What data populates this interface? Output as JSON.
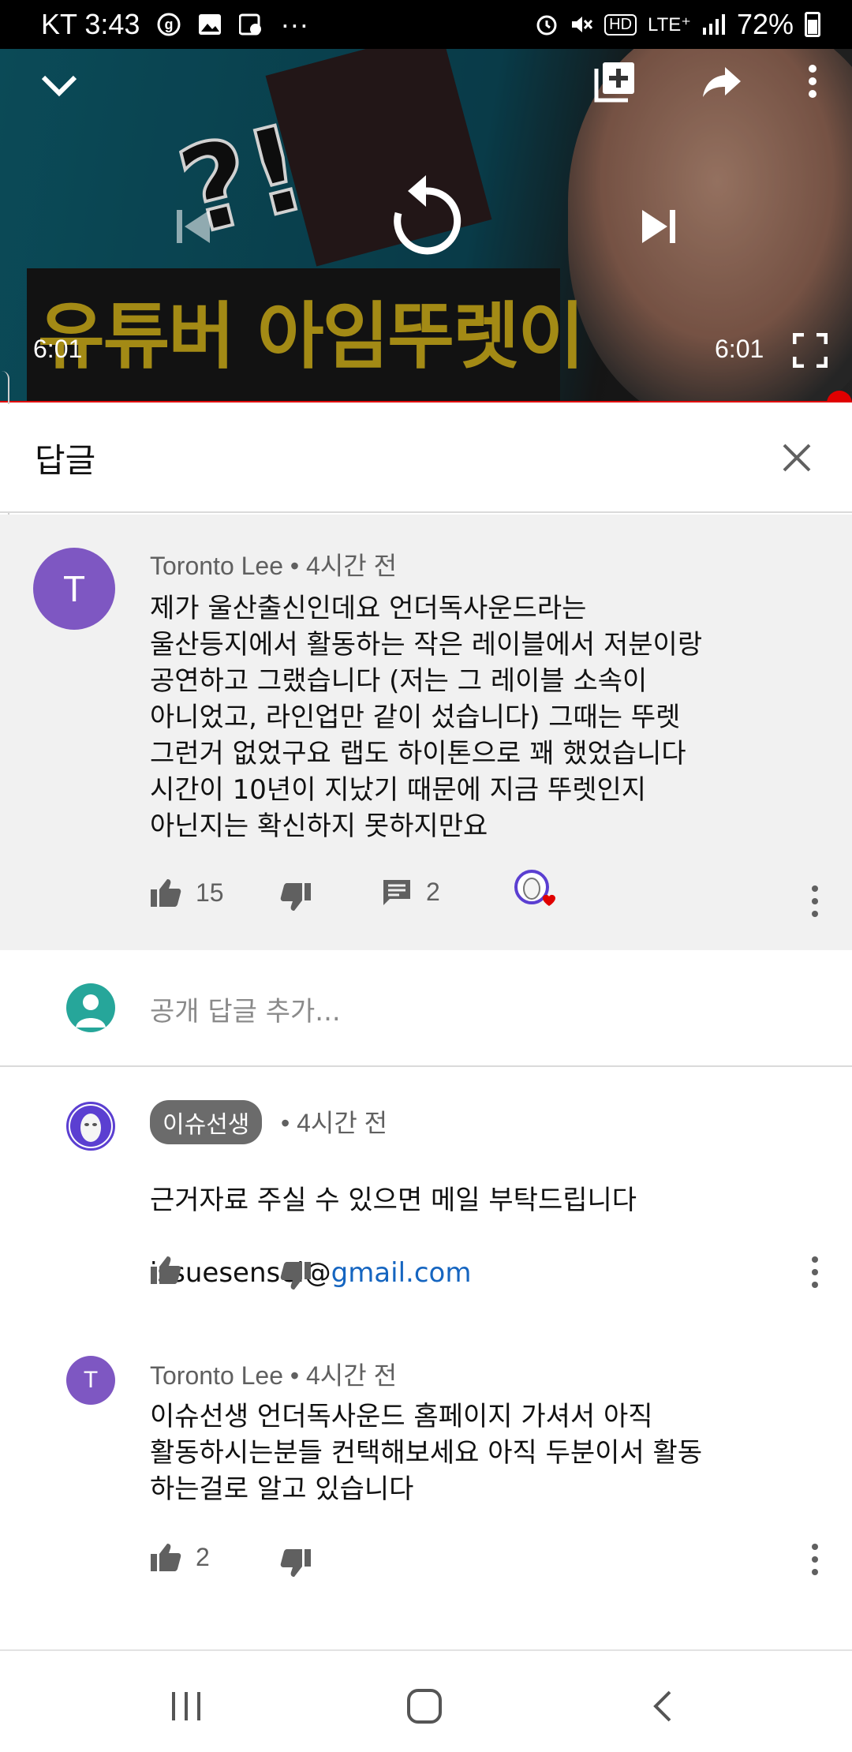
{
  "status_bar": {
    "carrier_time": "KT 3:43",
    "notif_icons": [
      "g-icon",
      "image-icon",
      "gallery-settings-icon"
    ],
    "more_dots": "···",
    "right_icons": [
      "alarm-icon",
      "mute-icon",
      "hd-icon",
      "lte-icon",
      "signal-icon"
    ],
    "lte_text": "LTE⁺",
    "hd_text": "HD",
    "battery_percent": "72%",
    "battery_level": 0.72
  },
  "video": {
    "thumbnail_title": "유튜버 아임뚜렛이",
    "thumbnail_mark": "?!",
    "elapsed": "6:01",
    "duration": "6:01",
    "progress": 1.0
  },
  "panel": {
    "title": "답글"
  },
  "parent_comment": {
    "avatar_letter": "T",
    "avatar_color": "#7e57c2",
    "author": "Toronto Lee",
    "separator": "•",
    "time": "4시간 전",
    "text": "제가 울산출신인데요 언더독사운드라는\n울산등지에서 활동하는 작은 레이블에서 저분이랑\n공연하고 그랬습니다 (저는 그 레이블 소속이\n아니었고, 라인업만 같이 섰습니다) 그때는 뚜렛\n그런거 없었구요 랩도 하이톤으로 꽤 했었습니다\n시간이 10년이 지났기 때문에 지금 뚜렛인지\n아닌지는 확신하지 못하지만요",
    "likes": "15",
    "replies": "2"
  },
  "add_reply": {
    "placeholder": "공개 답글 추가..."
  },
  "replies": [
    {
      "author": "이슈선생",
      "separator": "•",
      "time": "4시간 전",
      "text_line1": "근거자료 주실 수 있으면 메일 부탁드립니다",
      "text_prefix": "issuesensei@",
      "text_link": "gmail.com",
      "likes": ""
    },
    {
      "avatar_letter": "T",
      "author": "Toronto Lee",
      "separator": "•",
      "time": "4시간 전",
      "text": "이슈선생 언더독사운드 홈페이지 가셔서 아직\n활동하시는분들 컨택해보세요 아직 두분이서 활동\n하는걸로 알고 있습니다",
      "likes": "2"
    }
  ],
  "colors": {
    "progress": "#e00000",
    "link": "#1565c0",
    "avatar_purple": "#7e57c2",
    "avatar_teal": "#26a69a",
    "badge": "#6b6b6b"
  }
}
